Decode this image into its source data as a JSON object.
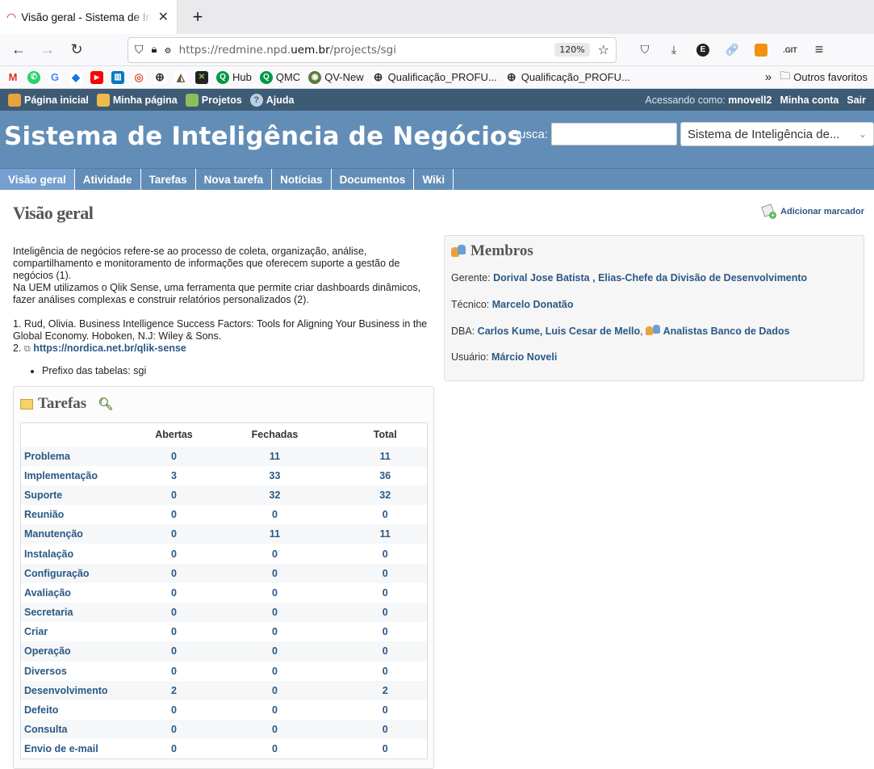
{
  "browser": {
    "tab_title": "Visão geral - Sistema de Inteligência de Negócios",
    "url_prefix": "https://redmine.npd.",
    "url_domain": "uem.br",
    "url_path": "/projects/sgi",
    "zoom": "120%",
    "bookmarks": [
      {
        "label": "",
        "icon": "gmail-icon"
      },
      {
        "label": "",
        "icon": "whatsapp-icon"
      },
      {
        "label": "",
        "icon": "google-icon"
      },
      {
        "label": "",
        "icon": "graduation-icon"
      },
      {
        "label": "",
        "icon": "youtube-icon"
      },
      {
        "label": "",
        "icon": "trello-icon"
      },
      {
        "label": "",
        "icon": "target-icon"
      },
      {
        "label": "",
        "icon": "globe-icon"
      },
      {
        "label": "",
        "icon": "app-icon"
      },
      {
        "label": "",
        "icon": "x-app-icon"
      },
      {
        "label": "Hub",
        "icon": "q-icon"
      },
      {
        "label": "QMC",
        "icon": "q-icon"
      },
      {
        "label": "QV-New",
        "icon": "qv-icon"
      },
      {
        "label": "Qualificação_PROFU...",
        "icon": "globe-icon"
      },
      {
        "label": "Qualificação_PROFU...",
        "icon": "globe-icon"
      }
    ],
    "other_bookmarks": "Outros favoritos"
  },
  "topmenu": {
    "home": "Página inicial",
    "mypage": "Minha página",
    "projects": "Projetos",
    "help": "Ajuda",
    "logged_label": "Acessando como:",
    "user": "mnovell2",
    "account": "Minha conta",
    "logout": "Sair"
  },
  "header": {
    "title": "Sistema de Inteligência de Negócios",
    "search_label": "Busca:",
    "project_select": "Sistema de Inteligência de..."
  },
  "mainmenu": [
    "Visão geral",
    "Atividade",
    "Tarefas",
    "Nova tarefa",
    "Notícias",
    "Documentos",
    "Wiki"
  ],
  "page": {
    "title": "Visão geral",
    "add_bookmark": "Adicionar marcador",
    "desc1": "Inteligência de negócios refere-se ao processo de coleta, organização, análise, compartilhamento e monitoramento de informações que oferecem suporte a gestão de negócios (1).",
    "desc2": "Na UEM utilizamos o Qlik Sense, uma ferramenta que permite criar dashboards dinâmicos, fazer análises complexas e construir relatórios personalizados (2).",
    "ref1": "1. Rud, Olivia. Business Intelligence Success Factors: Tools for Aligning Your Business in the Global Economy. Hoboken, N.J: Wiley & Sons.",
    "ref2_prefix": "2.",
    "ref2_link": "https://nordica.net.br/qlik-sense",
    "bullet": "Prefixo das tabelas: sgi"
  },
  "tarefas": {
    "title": "Tarefas",
    "headers": [
      "",
      "Abertas",
      "Fechadas",
      "Total"
    ],
    "rows": [
      [
        "Problema",
        "0",
        "11",
        "11"
      ],
      [
        "Implementação",
        "3",
        "33",
        "36"
      ],
      [
        "Suporte",
        "0",
        "32",
        "32"
      ],
      [
        "Reunião",
        "0",
        "0",
        "0"
      ],
      [
        "Manutenção",
        "0",
        "11",
        "11"
      ],
      [
        "Instalação",
        "0",
        "0",
        "0"
      ],
      [
        "Configuração",
        "0",
        "0",
        "0"
      ],
      [
        "Avaliação",
        "0",
        "0",
        "0"
      ],
      [
        "Secretaria",
        "0",
        "0",
        "0"
      ],
      [
        "Criar",
        "0",
        "0",
        "0"
      ],
      [
        "Operação",
        "0",
        "0",
        "0"
      ],
      [
        "Diversos",
        "0",
        "0",
        "0"
      ],
      [
        "Desenvolvimento",
        "2",
        "0",
        "2"
      ],
      [
        "Defeito",
        "0",
        "0",
        "0"
      ],
      [
        "Consulta",
        "0",
        "0",
        "0"
      ],
      [
        "Envio de e-mail",
        "0",
        "0",
        "0"
      ]
    ]
  },
  "membros": {
    "title": "Membros",
    "gerente_label": "Gerente:",
    "gerente_1": "Dorival Jose Batista",
    "gerente_2": "Elias-Chefe da Divisão de Desenvolvimento",
    "tecnico_label": "Técnico:",
    "tecnico": "Marcelo Donatão",
    "dba_label": "DBA:",
    "dba_1": "Carlos Kume",
    "dba_2": "Luis Cesar de Mello",
    "dba_group": "Analistas Banco de Dados",
    "usuario_label": "Usuário:",
    "usuario": "Márcio Noveli"
  }
}
